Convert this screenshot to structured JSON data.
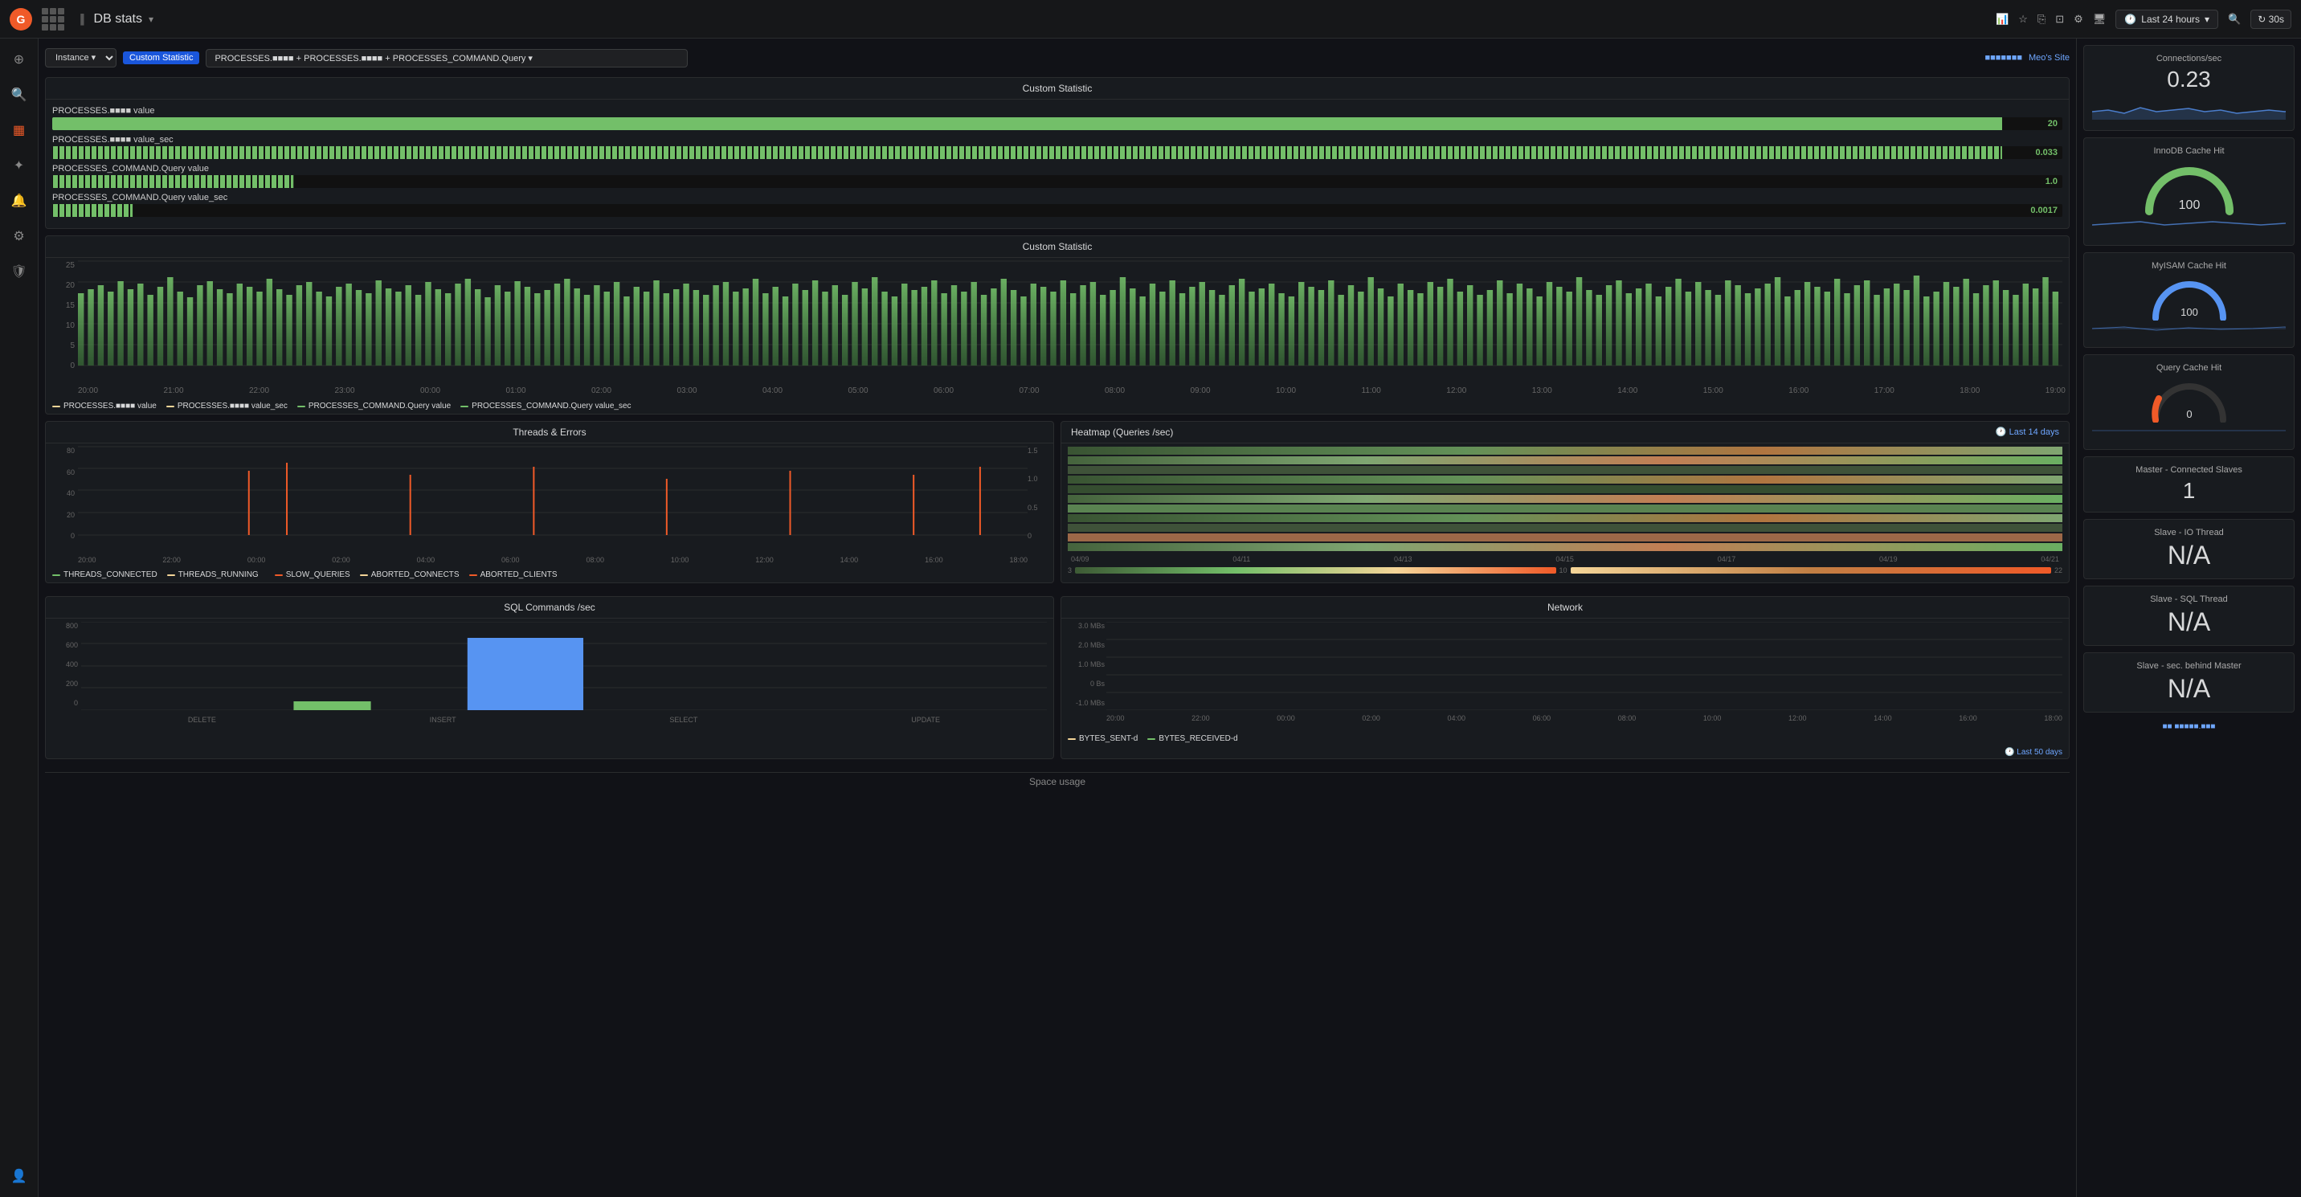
{
  "topnav": {
    "logo_char": "G",
    "title": "DB stats",
    "chevron": "▾",
    "time_range": "Last 24 hours",
    "refresh_interval": "30s",
    "app_name": "Meo's Site"
  },
  "toolbar": {
    "select_label": "Instance ▾",
    "badge_label": "Custom Statistic",
    "query_value": "PROCESSES.■■■■ + PROCESSES.■■■■ + PROCESSES_COMMAND.Query ▾",
    "link1": "■■■■■■■",
    "link2": "Meo's Site"
  },
  "custom_statistic_panel1": {
    "title": "Custom Statistic",
    "rows": [
      {
        "label": "PROCESSES.■■■■ value",
        "fill_pct": 97,
        "value": "20",
        "color": "#73bf69"
      },
      {
        "label": "PROCESSES.■■■■ value_sec",
        "fill_pct": 97,
        "value": "0.033",
        "color": "#73bf69"
      },
      {
        "label": "PROCESSES_COMMAND.Query value",
        "fill_pct": 12,
        "value": "1.0",
        "color": "#73bf69"
      },
      {
        "label": "PROCESSES_COMMAND.Query value_sec",
        "fill_pct": 4,
        "value": "0.0017",
        "color": "#73bf69"
      }
    ]
  },
  "custom_statistic_panel2": {
    "title": "Custom Statistic",
    "y_labels": [
      "25",
      "20",
      "15",
      "10",
      "5",
      "0"
    ],
    "x_labels": [
      "20:00",
      "21:00",
      "22:00",
      "23:00",
      "00:00",
      "01:00",
      "02:00",
      "03:00",
      "04:00",
      "05:00",
      "06:00",
      "07:00",
      "08:00",
      "09:00",
      "10:00",
      "11:00",
      "12:00",
      "13:00",
      "14:00",
      "15:00",
      "16:00",
      "17:00",
      "18:00",
      "19:00"
    ],
    "legend": [
      {
        "label": "PROCESSES.■■■■ value",
        "color": "#f4d598"
      },
      {
        "label": "PROCESSES.■■■■ value_sec",
        "color": "#f4d598"
      },
      {
        "label": "PROCESSES_COMMAND.Query value",
        "color": "#f4d598"
      },
      {
        "label": "PROCESSES_COMMAND.Query value_sec",
        "color": "#f4d598"
      }
    ]
  },
  "threads_errors": {
    "title": "Threads & Errors",
    "y_labels": [
      "80",
      "60",
      "40",
      "20",
      "0"
    ],
    "y_labels_right": [
      "1.5",
      "1.0",
      "0.5",
      "0"
    ],
    "x_labels": [
      "20:00",
      "22:00",
      "00:00",
      "02:00",
      "04:00",
      "06:00",
      "08:00",
      "10:00",
      "12:00",
      "14:00",
      "16:00",
      "18:00"
    ],
    "legend": [
      {
        "label": "THREADS_CONNECTED",
        "color": "#73bf69"
      },
      {
        "label": "THREADS_RUNNING",
        "color": "#f4d598"
      },
      {
        "label": "SLOW_QUERIES",
        "color": "#f05a28"
      },
      {
        "label": "ABORTED_CONNECTS",
        "color": "#f4d598"
      },
      {
        "label": "ABORTED_CLIENTS",
        "color": "#f05a28"
      }
    ]
  },
  "heatmap": {
    "title": "Heatmap (Queries /sec)",
    "time_label": "Last 14 days",
    "x_labels": [
      "04/09",
      "04/11",
      "04/13",
      "04/15",
      "04/17",
      "04/19",
      "04/21"
    ],
    "legend_values": [
      "3",
      "10",
      "22"
    ]
  },
  "sql_commands": {
    "title": "SQL Commands /sec",
    "y_labels": [
      "800",
      "600",
      "400",
      "200",
      "0"
    ],
    "x_labels": [
      "DELETE",
      "INSERT",
      "SELECT",
      "UPDATE"
    ]
  },
  "network": {
    "title": "Network",
    "y_labels": [
      "3.0 MBs",
      "2.0 MBs",
      "1.0 MBs",
      "0 Bs",
      "-1.0 MBs"
    ],
    "x_labels": [
      "20:00",
      "22:00",
      "00:00",
      "02:00",
      "04:00",
      "06:00",
      "08:00",
      "10:00",
      "12:00",
      "14:00",
      "16:00",
      "18:00"
    ],
    "legend": [
      {
        "label": "BYTES_SENT-d",
        "color": "#f4d598"
      },
      {
        "label": "BYTES_RECEIVED-d",
        "color": "#73bf69"
      }
    ],
    "time_label": "Last 50 days"
  },
  "right_sidebar": {
    "cards": [
      {
        "id": "connections",
        "title": "Connections/sec",
        "value": "0.23",
        "type": "number"
      },
      {
        "id": "innodb",
        "title": "InnoDB Cache Hit",
        "value": "100",
        "type": "gauge",
        "gauge_color": "#73bf69"
      },
      {
        "id": "myisam",
        "title": "MyISAM Cache Hit",
        "value": "100",
        "type": "gauge_mini",
        "gauge_color": "#5794f2"
      },
      {
        "id": "query_cache",
        "title": "Query Cache Hit",
        "value": "0",
        "type": "gauge_small",
        "gauge_color": "#f05a28"
      },
      {
        "id": "master_slaves",
        "title": "Master - Connected Slaves",
        "value": "1",
        "type": "number"
      },
      {
        "id": "slave_io",
        "title": "Slave - IO Thread",
        "value": "N/A",
        "type": "na"
      },
      {
        "id": "slave_sql",
        "title": "Slave - SQL Thread",
        "value": "N/A",
        "type": "na"
      },
      {
        "id": "slave_behind",
        "title": "Slave - sec. behind Master",
        "value": "N/A",
        "type": "na"
      }
    ],
    "bottom_link": "■■ ■■■■■.■■■"
  },
  "space_usage_label": "Space usage"
}
